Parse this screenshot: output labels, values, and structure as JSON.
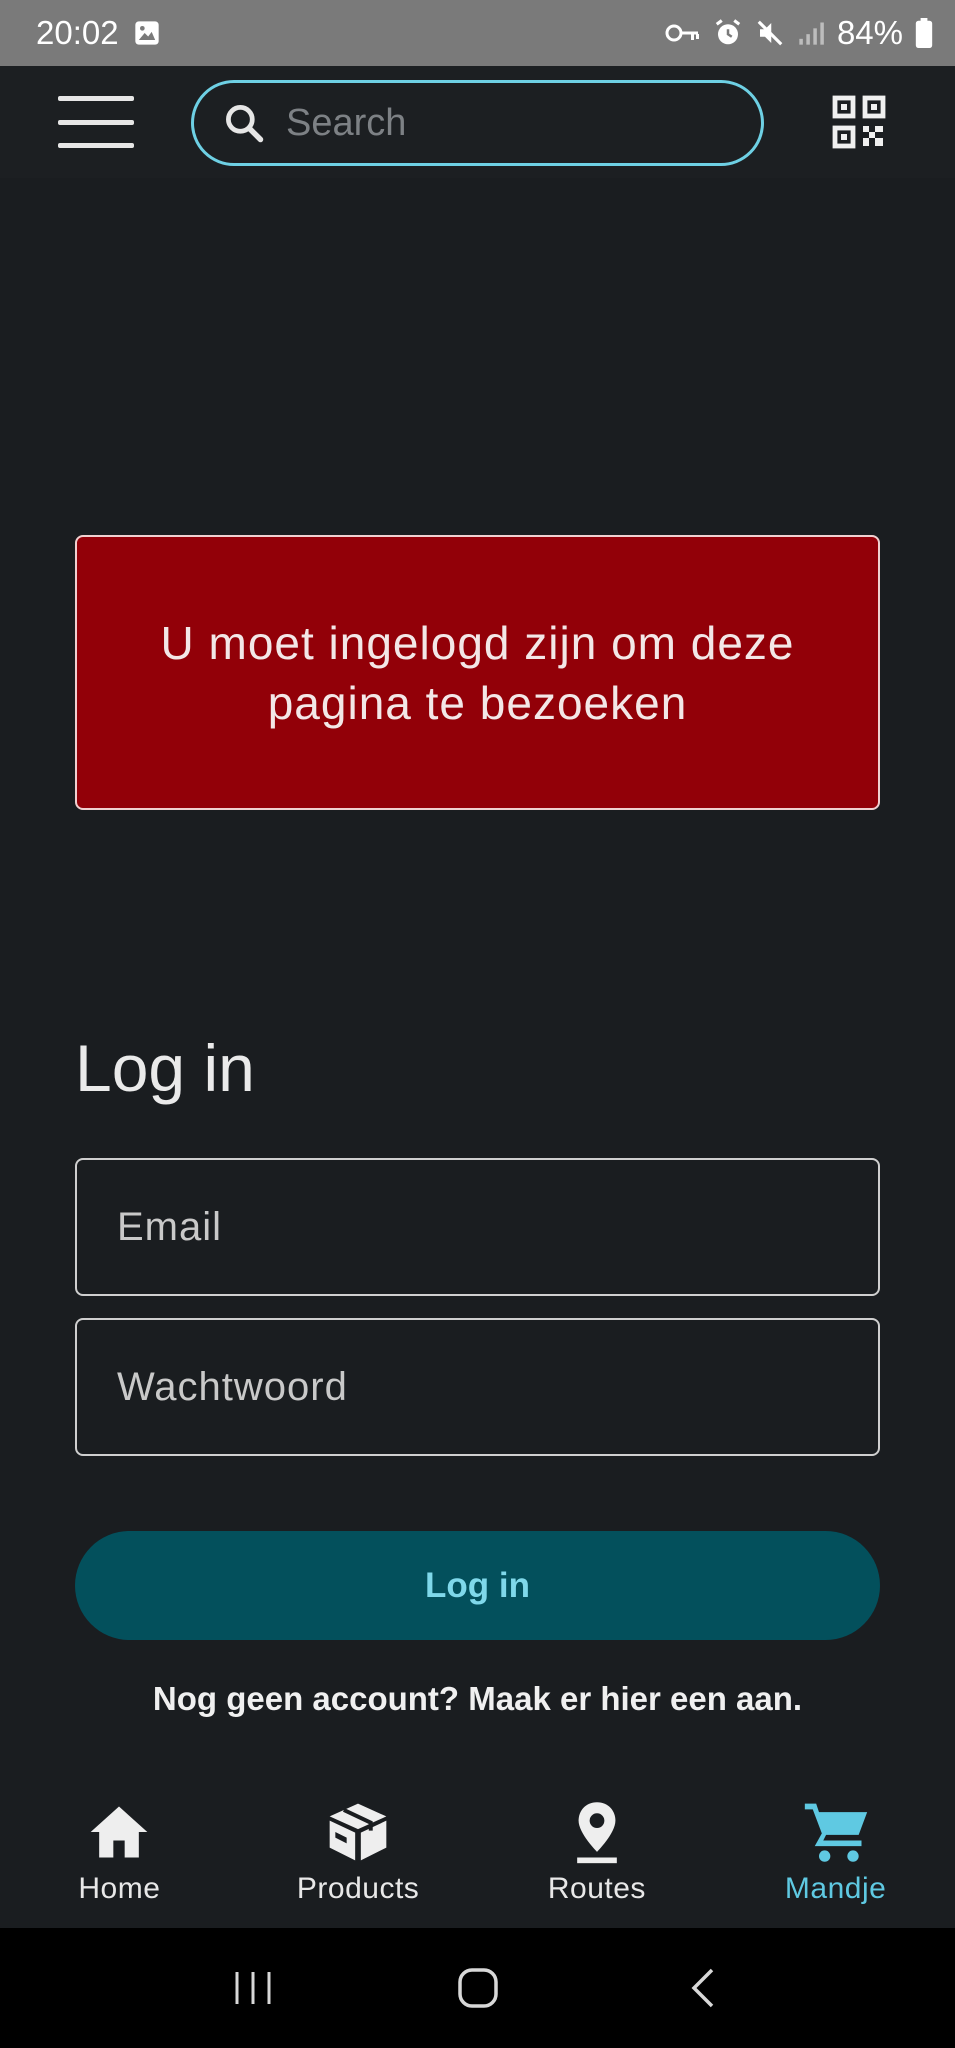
{
  "status_bar": {
    "time": "20:02",
    "battery": "84%",
    "icons": [
      "image-icon",
      "key-icon",
      "alarm-icon",
      "mute-icon",
      "signal-icon",
      "battery-icon"
    ]
  },
  "header": {
    "menu_icon": "hamburger-menu-icon",
    "search": {
      "placeholder": "Search",
      "value": ""
    },
    "qr_icon": "qr-code-scan-icon",
    "accent_color": "#6ed0e4"
  },
  "alert": {
    "message": "U moet ingelogd zijn om deze pagina te bezoeken",
    "background": "#920008"
  },
  "login": {
    "title": "Log in",
    "email": {
      "placeholder": "Email",
      "value": ""
    },
    "password": {
      "placeholder": "Wachtwoord",
      "value": ""
    },
    "submit_label": "Log in",
    "register_text": "Nog geen account? Maak er hier een aan."
  },
  "bottom_nav": {
    "items": [
      {
        "label": "Home",
        "icon": "home-icon",
        "active": false
      },
      {
        "label": "Products",
        "icon": "box-icon",
        "active": false
      },
      {
        "label": "Routes",
        "icon": "map-pin-icon",
        "active": false
      },
      {
        "label": "Mandje",
        "icon": "cart-icon",
        "active": true
      }
    ],
    "active_color": "#5fc9e2"
  },
  "system_nav": {
    "buttons": [
      "recent-apps-icon",
      "home-circle-icon",
      "back-icon"
    ]
  }
}
